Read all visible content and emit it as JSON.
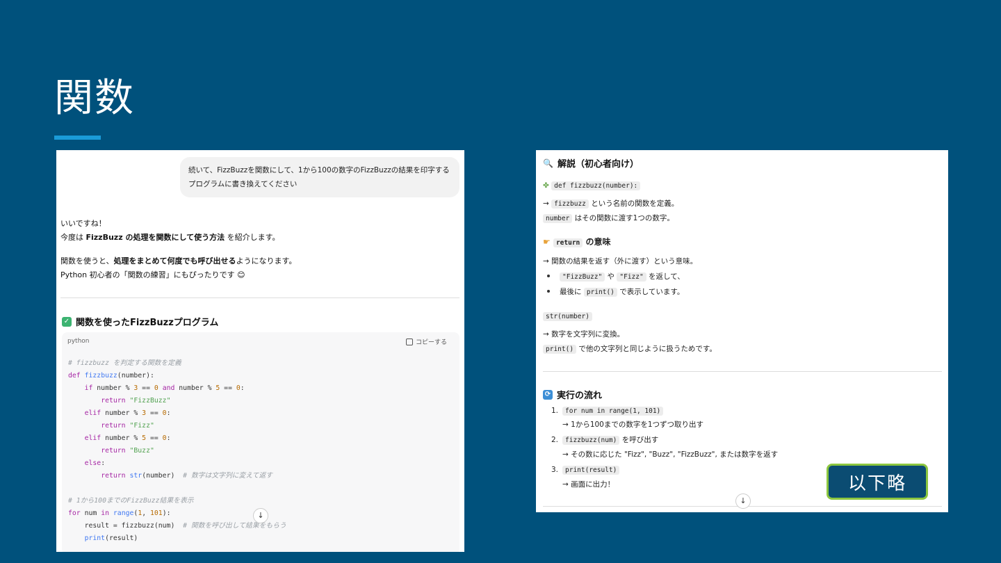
{
  "slide": {
    "title": "関数",
    "omitted_button": "以下略",
    "accent_color": "#1a9bd8"
  },
  "left": {
    "user_prompt": "続いて、FizzBuzzを関数にして、1から100の数字のFizzBuzzの結果を印字するプログラムに書き換えてください",
    "reply_line1": "いいですね！",
    "reply_line2_pre": "今度は ",
    "reply_line2_bold": "FizzBuzz の処理を関数にして使う方法",
    "reply_line2_post": " を紹介します。",
    "reply_line3_pre": "関数を使うと、",
    "reply_line3_bold": "処理をまとめて何度でも呼び出せる",
    "reply_line3_post": "ようになります。",
    "reply_line4": "Python 初心者の「関数の練習」にもぴったりです 😊",
    "section_title": "関数を使ったFizzBuzzプログラム",
    "code_lang": "python",
    "copy_label": "コピーする",
    "code_lines": [
      "# fizzbuzz を判定する関数を定義",
      "def fizzbuzz(number):",
      "    if number % 3 == 0 and number % 5 == 0:",
      "        return \"FizzBuzz\"",
      "    elif number % 3 == 0:",
      "        return \"Fizz\"",
      "    elif number % 5 == 0:",
      "        return \"Buzz\"",
      "    else:",
      "        return str(number)  # 数字は文字列に変えて返す",
      "",
      "# 1から100までのFizzBuzz結果を表示",
      "for num in range(1, 101):",
      "    result = fizzbuzz(num)  # 関数を呼び出して結果をもらう",
      "    print(result)"
    ]
  },
  "right": {
    "explain_title": "解説（初心者向け）",
    "def_code": "def fizzbuzz(number):",
    "def_l1_code": "fizzbuzz",
    "def_l1_text": " という名前の関数を定義。",
    "def_l2_code": "number",
    "def_l2_text": " はその関数に渡す1つの数字。",
    "return_code": "return",
    "return_title": " の意味",
    "return_l1": "→ 関数の結果を返す（外に渡す）という意味。",
    "return_b1_code1": "\"FizzBuzz\"",
    "return_b1_mid": " や ",
    "return_b1_code2": "\"Fizz\"",
    "return_b1_post": " を返して、",
    "return_b2_pre": "最後に ",
    "return_b2_code": "print()",
    "return_b2_post": " で表示しています。",
    "str_code": "str(number)",
    "str_l1": "→ 数字を文字列に変換。",
    "str_l2_code": "print()",
    "str_l2_text": " で他の文字列と同じように扱うためです。",
    "flow_title": "実行の流れ",
    "flow": [
      {
        "num": "1.",
        "code": "for num in range(1, 101)",
        "after": "",
        "sub": "→ 1から100までの数字を1つずつ取り出す"
      },
      {
        "num": "2.",
        "code": "fizzbuzz(num)",
        "after": " を呼び出す",
        "sub": "→ その数に応じた \"Fizz\", \"Buzz\", \"FizzBuzz\", または数字を返す"
      },
      {
        "num": "3.",
        "code": "print(result)",
        "after": "",
        "sub": "→ 画面に出力！"
      }
    ]
  }
}
